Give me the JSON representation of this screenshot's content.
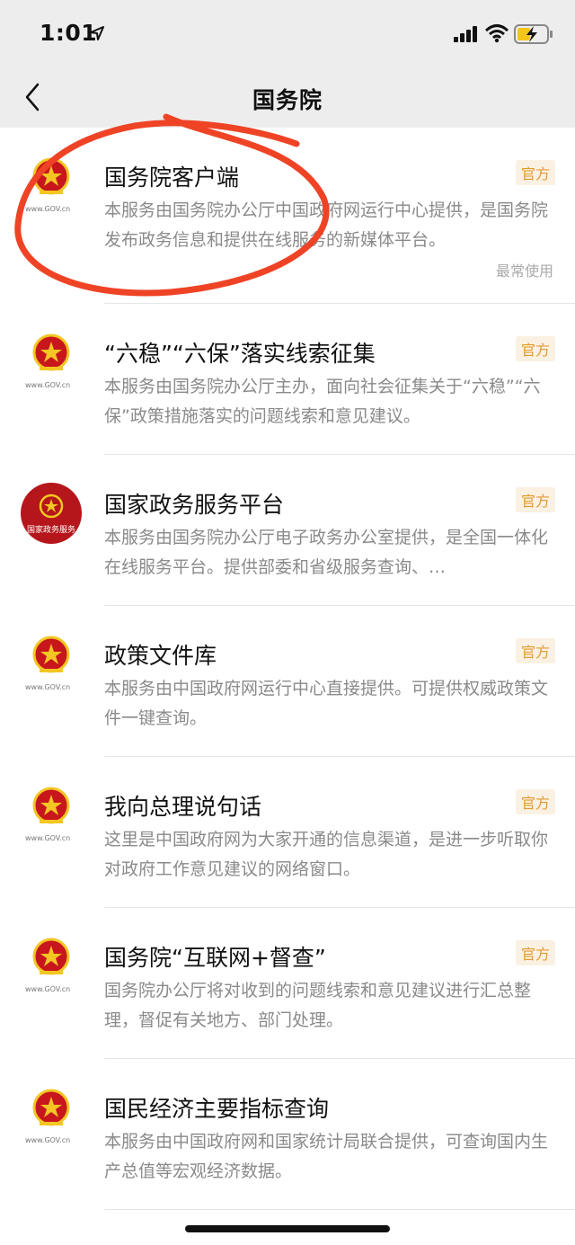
{
  "status_bar": {
    "time": "1:01"
  },
  "nav": {
    "title": "国务院"
  },
  "list": [
    {
      "title": "国务院客户端",
      "badge": "官方",
      "desc": "本服务由国务院办公厅中国政府网运行中心提供，是国务院发布政务信息和提供在线服务的新媒体平台。",
      "extra": "最常使用",
      "logo": "gov-emblem",
      "logo_text": "www.GOV.cn"
    },
    {
      "title": "“六稳”“六保”落实线索征集",
      "badge": "官方",
      "desc": "本服务由国务院办公厅主办，面向社会征集关于“六稳”“六保”政策措施落实的问题线索和意见建议。",
      "logo": "gov-emblem",
      "logo_text": "www.GOV.cn"
    },
    {
      "title": "国家政务服务平台",
      "badge": "官方",
      "desc": "本服务由国务院办公厅电子政务办公室提供，是全国一体化在线服务平台。提供部委和省级服务查询、…",
      "logo": "gov-service-emblem",
      "logo_text": "国家政务服务"
    },
    {
      "title": "政策文件库",
      "badge": "官方",
      "desc": "本服务由中国政府网运行中心直接提供。可提供权威政策文件一键查询。",
      "logo": "gov-emblem",
      "logo_text": "www.GOV.cn"
    },
    {
      "title": "我向总理说句话",
      "badge": "官方",
      "desc": "这里是中国政府网为大家开通的信息渠道，是进一步听取你对政府工作意见建议的网络窗口。",
      "logo": "gov-emblem",
      "logo_text": "www.GOV.cn"
    },
    {
      "title": "国务院“互联网+督查”",
      "badge": "官方",
      "desc": "国务院办公厅将对收到的问题线索和意见建议进行汇总整理，督促有关地方、部门处理。",
      "logo": "gov-emblem",
      "logo_text": "www.GOV.cn"
    },
    {
      "title": "国民经济主要指标查询",
      "badge": "",
      "desc": "本服务由中国政府网和国家统计局联合提供，可查询国内生产总值等宏观经济数据。",
      "logo": "gov-emblem",
      "logo_text": "www.GOV.cn"
    }
  ],
  "colors": {
    "badge_text": "#e39a34",
    "annotation_red": "#ef4326",
    "emblem_red": "#c8161d",
    "emblem_gold": "#f3c623"
  }
}
